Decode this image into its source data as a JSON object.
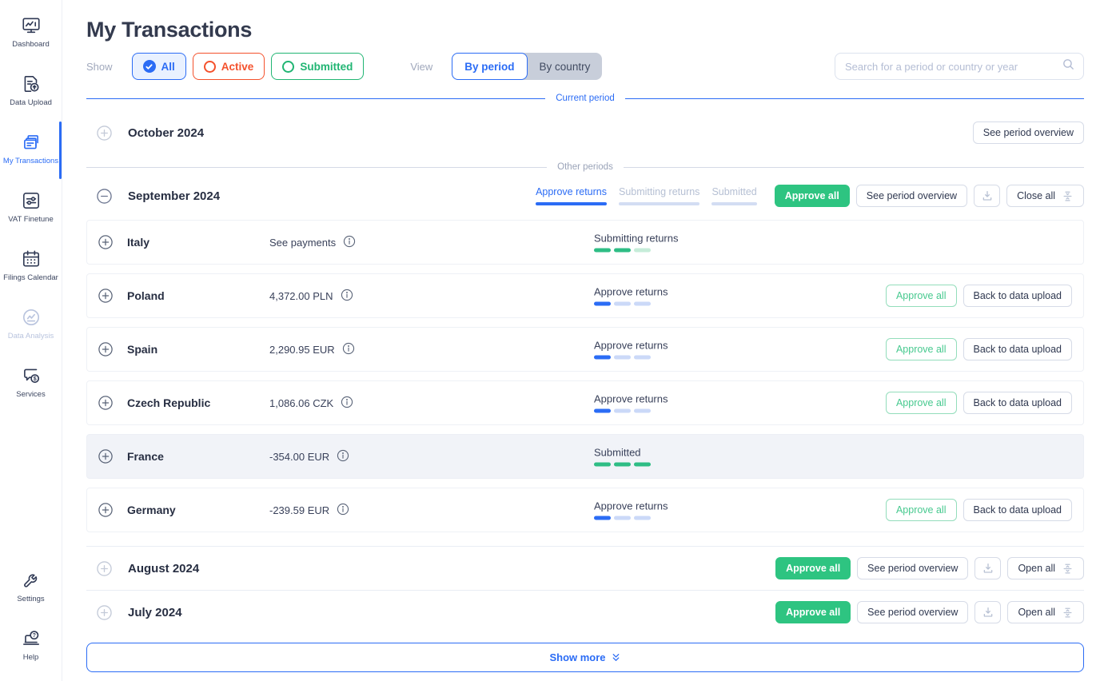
{
  "sidebar": {
    "items": [
      {
        "label": "Dashboard"
      },
      {
        "label": "Data Upload"
      },
      {
        "label": "My Transactions"
      },
      {
        "label": "VAT Finetune"
      },
      {
        "label": "Filings Calendar"
      },
      {
        "label": "Data Analysis"
      },
      {
        "label": "Services"
      }
    ],
    "settings_label": "Settings",
    "help_label": "Help"
  },
  "header": {
    "title": "My Transactions",
    "show_label": "Show",
    "filter_all": "All",
    "filter_active": "Active",
    "filter_submitted": "Submitted",
    "view_label": "View",
    "view_by_period": "By period",
    "view_by_country": "By country",
    "search_placeholder": "Search for a period or country or year"
  },
  "dividers": {
    "current_period": "Current period",
    "other_periods": "Other periods"
  },
  "actions": {
    "see_period_overview": "See period overview",
    "approve_all": "Approve all",
    "back_to_data_upload": "Back to data upload",
    "close_all": "Close all",
    "open_all": "Open all",
    "show_more": "Show more"
  },
  "colors": {
    "primary_blue": "#2b6cf5",
    "green": "#2ec481",
    "red": "#f4512c",
    "progress_blue": "#2b6cf5",
    "progress_blue_empty": "#cbd9f8",
    "progress_green": "#2ebd85",
    "progress_green_empty": "#c6ecd9"
  },
  "periods": {
    "october": {
      "name": "October 2024",
      "expanded": false
    },
    "september": {
      "name": "September 2024",
      "expanded": true,
      "tabs": [
        {
          "label": "Approve returns",
          "active": true
        },
        {
          "label": "Submitting returns",
          "active": false
        },
        {
          "label": "Submitted",
          "active": false
        }
      ],
      "countries": [
        {
          "name": "Italy",
          "amount": "See payments",
          "status": "Submitting returns",
          "progress": {
            "filled": 2,
            "total": 3,
            "color": "#2ebd85",
            "empty_color": "#c6ecd9"
          },
          "has_actions": false,
          "highlighted": false
        },
        {
          "name": "Poland",
          "amount": "4,372.00 PLN",
          "status": "Approve returns",
          "progress": {
            "filled": 1,
            "total": 3,
            "color": "#2b6cf5",
            "empty_color": "#cbd9f8"
          },
          "has_actions": true,
          "highlighted": false
        },
        {
          "name": "Spain",
          "amount": "2,290.95 EUR",
          "status": "Approve returns",
          "progress": {
            "filled": 1,
            "total": 3,
            "color": "#2b6cf5",
            "empty_color": "#cbd9f8"
          },
          "has_actions": true,
          "highlighted": false
        },
        {
          "name": "Czech Republic",
          "amount": "1,086.06 CZK",
          "status": "Approve returns",
          "progress": {
            "filled": 1,
            "total": 3,
            "color": "#2b6cf5",
            "empty_color": "#cbd9f8"
          },
          "has_actions": true,
          "highlighted": false
        },
        {
          "name": "France",
          "amount": "-354.00 EUR",
          "status": "Submitted",
          "progress": {
            "filled": 3,
            "total": 3,
            "color": "#2ebd85",
            "empty_color": "#c6ecd9"
          },
          "has_actions": false,
          "highlighted": true
        },
        {
          "name": "Germany",
          "amount": "-239.59 EUR",
          "status": "Approve returns",
          "progress": {
            "filled": 1,
            "total": 3,
            "color": "#2b6cf5",
            "empty_color": "#cbd9f8"
          },
          "has_actions": true,
          "highlighted": false
        }
      ]
    },
    "august": {
      "name": "August 2024",
      "expanded": false
    },
    "july": {
      "name": "July 2024",
      "expanded": false
    }
  }
}
